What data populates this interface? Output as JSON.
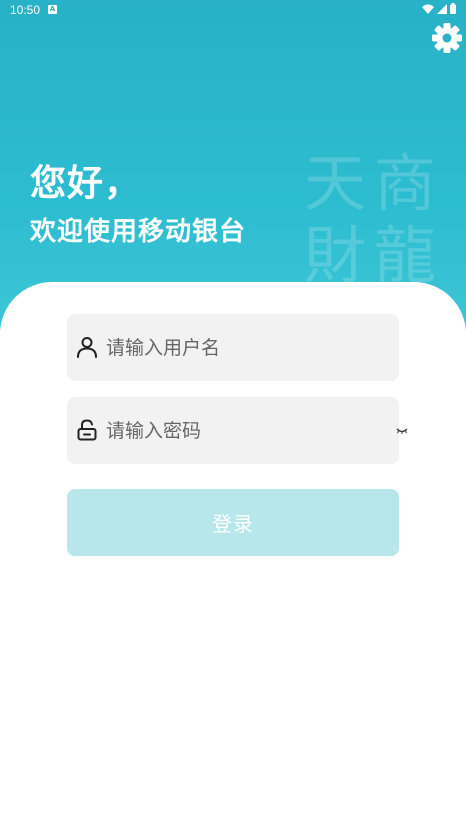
{
  "status_bar": {
    "time": "10:50",
    "notification_letter": "A",
    "icons": [
      "wifi-icon",
      "signal-icon",
      "battery-icon"
    ]
  },
  "header": {
    "greeting": "您好，",
    "welcome": "欢迎使用移动银台",
    "watermark_chars": [
      "天",
      "商",
      "財",
      "龍"
    ],
    "settings_icon": "gear-icon"
  },
  "form": {
    "username": {
      "value": "",
      "placeholder": "请输入用户名",
      "icon": "user-icon"
    },
    "password": {
      "value": "",
      "placeholder": "请输入密码",
      "icon": "lock-icon",
      "toggle_icon": "eye-closed-icon"
    },
    "login_label": "登录"
  },
  "colors": {
    "header_top": "#28b1c7",
    "header_bottom": "#3cc6d6",
    "field_bg": "#f2f2f2",
    "button_disabled": "#b7e6eb",
    "text_white": "#ffffff"
  }
}
